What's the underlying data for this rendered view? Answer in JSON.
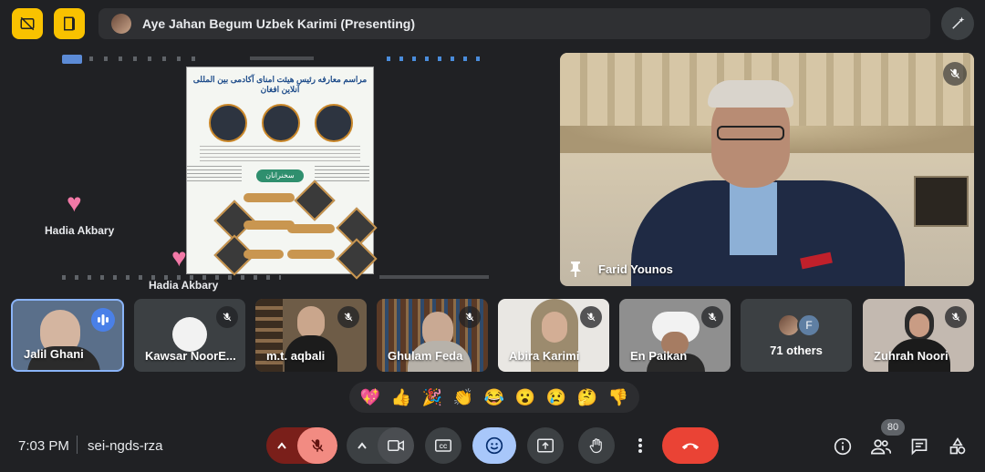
{
  "header": {
    "presenter_label": "Aye Jahan Begum Uzbek Karimi (Presenting)"
  },
  "reactions": {
    "left_name": "Hadia Akbary",
    "center_name": "Hadia Akbary"
  },
  "main_speaker": {
    "name": "Farid Younos"
  },
  "participants": [
    {
      "name": "Jalil Ghani",
      "mic": "speaking"
    },
    {
      "name": "Kawsar NoorE...",
      "mic": "muted"
    },
    {
      "name": "m.t. aqbali",
      "mic": "muted"
    },
    {
      "name": "Ghulam Feda",
      "mic": "muted"
    },
    {
      "name": "Abira Karimi",
      "mic": "muted"
    },
    {
      "name": "En Paikan",
      "mic": "muted"
    },
    {
      "name": "71 others",
      "avatar_letter": "F"
    },
    {
      "name": "Zuhrah Noori",
      "mic": "muted"
    }
  ],
  "emoji_reactions": [
    "💖",
    "👍",
    "🎉",
    "👏",
    "😂",
    "😮",
    "😢",
    "🤔",
    "👎"
  ],
  "footer": {
    "time": "7:03 PM",
    "meeting_code": "sei-ngds-rza",
    "participant_count": "80"
  },
  "poster": {
    "heading": "مراسم معارفه رئیس هیئت امنای آکادمی بین المللی آنلاین افغان",
    "band_label": "سخنرانان"
  },
  "icons": {
    "accent_yellow": "#f9c200",
    "end_call_red": "#ea4335",
    "mic_off_red_bg": "#f28b82"
  }
}
